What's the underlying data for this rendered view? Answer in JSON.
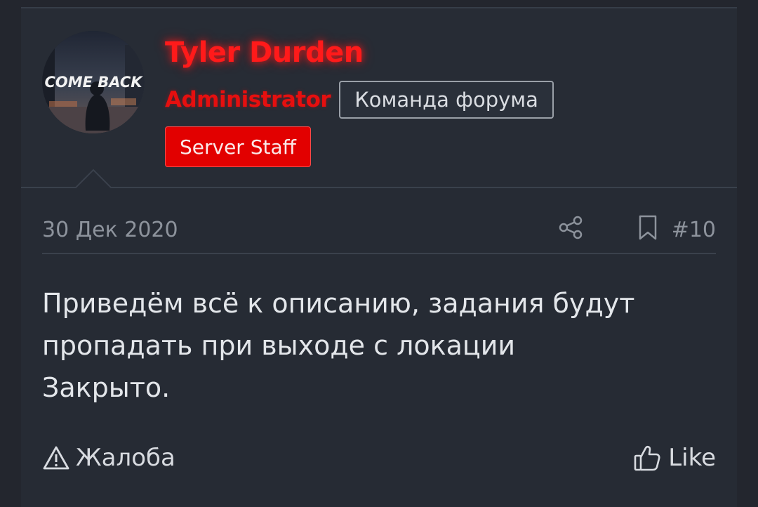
{
  "user": {
    "name": "Tyler Durden",
    "role": "Administrator",
    "team_badge": "Команда форума",
    "staff_badge": "Server Staff",
    "avatar_text": "COME BACK",
    "name_color": "#ff1a1a",
    "badge_color": "#e20000"
  },
  "post": {
    "date": "30 Дек 2020",
    "number": "#10",
    "message_lines": [
      "Приведём всё к описанию, задания будут",
      "пропадать при выходе с локации",
      "Закрыто."
    ]
  },
  "actions": {
    "report_label": "Жалоба",
    "like_label": "Like"
  },
  "icons": {
    "share": "share-icon",
    "bookmark": "bookmark-icon",
    "report": "warning-triangle-icon",
    "like": "thumbs-up-icon"
  }
}
